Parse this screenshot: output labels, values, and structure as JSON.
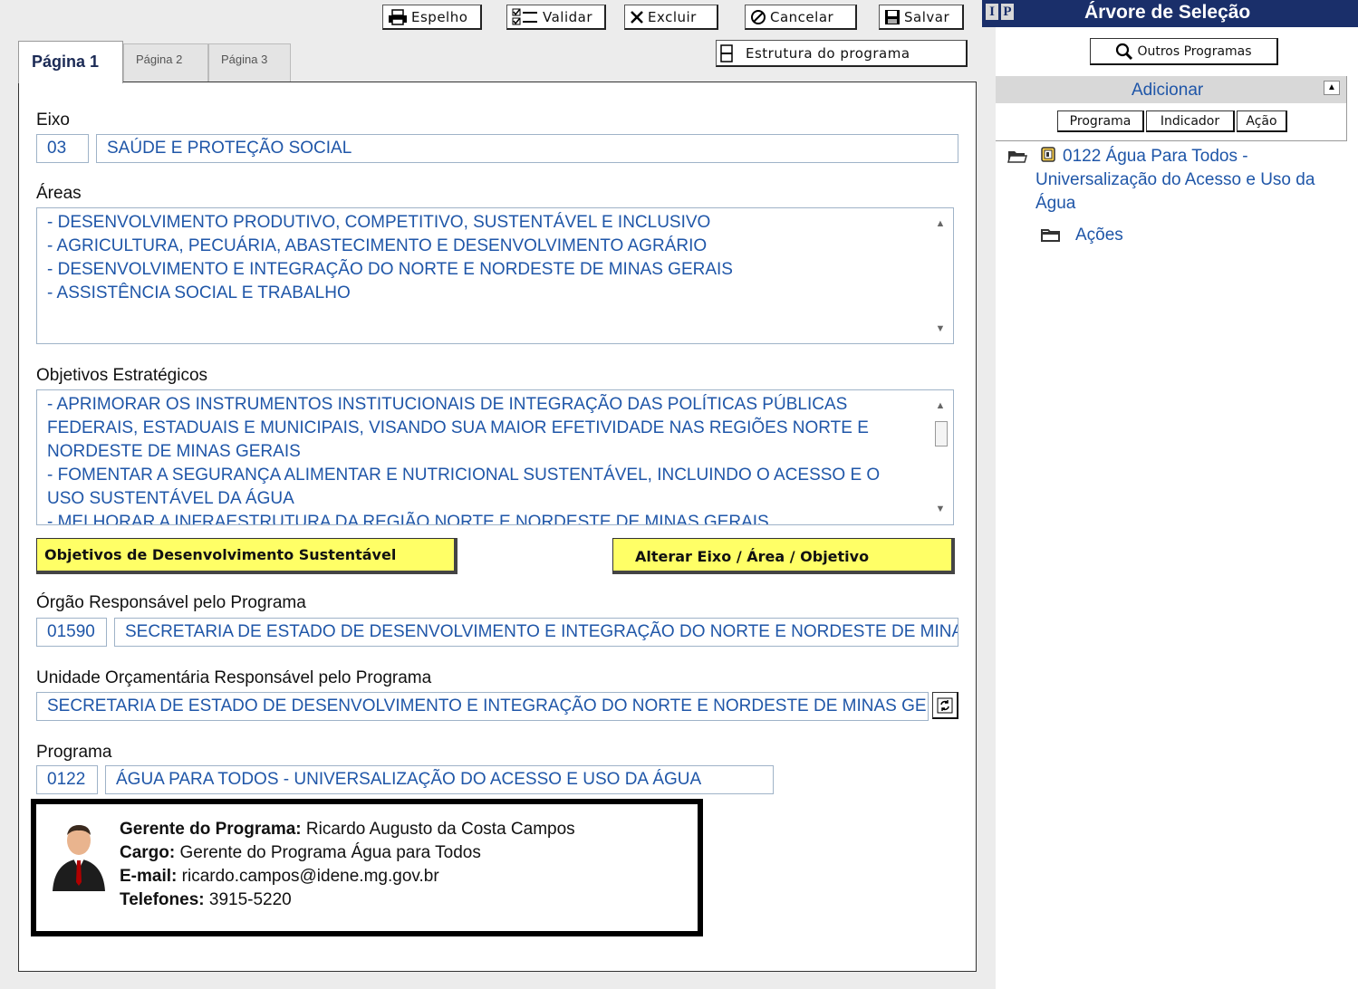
{
  "toolbar": {
    "espelho": "Espelho",
    "validar": "Validar",
    "excluir": "Excluir",
    "cancelar": "Cancelar",
    "salvar": "Salvar",
    "estrutura": "Estrutura do programa"
  },
  "tabs": [
    {
      "label": "Página 1",
      "active": true
    },
    {
      "label": "Página 2",
      "active": false
    },
    {
      "label": "Página 3",
      "active": false
    }
  ],
  "form": {
    "eixo": {
      "label": "Eixo",
      "code": "03",
      "name": "SAÚDE E PROTEÇÃO SOCIAL"
    },
    "areas": {
      "label": "Áreas",
      "items": [
        "- DESENVOLVIMENTO PRODUTIVO, COMPETITIVO, SUSTENTÁVEL E INCLUSIVO",
        "- AGRICULTURA, PECUÁRIA, ABASTECIMENTO E DESENVOLVIMENTO AGRÁRIO",
        "- DESENVOLVIMENTO E INTEGRAÇÃO DO NORTE E NORDESTE DE MINAS GERAIS",
        "- ASSISTÊNCIA SOCIAL E TRABALHO"
      ]
    },
    "objetivos": {
      "label": "Objetivos Estratégicos",
      "items": [
        "- APRIMORAR OS INSTRUMENTOS INSTITUCIONAIS DE INTEGRAÇÃO DAS POLÍTICAS PÚBLICAS FEDERAIS, ESTADUAIS E MUNICIPAIS, VISANDO SUA MAIOR EFETIVIDADE NAS REGIÕES NORTE E NORDESTE DE MINAS GERAIS",
        "- FOMENTAR A SEGURANÇA ALIMENTAR E NUTRICIONAL SUSTENTÁVEL, INCLUINDO O ACESSO E O USO SUSTENTÁVEL DA ÁGUA",
        "- MELHORAR A INFRAESTRUTURA DA REGIÃO NORTE E NORDESTE DE MINAS GERAIS"
      ]
    },
    "btn_ods": "Objetivos de Desenvolvimento Sustentável",
    "btn_alterar": "Alterar Eixo / Área / Objetivo",
    "orgao": {
      "label": "Órgão Responsável pelo Programa",
      "code": "01590",
      "name": "SECRETARIA DE ESTADO DE DESENVOLVIMENTO E INTEGRAÇÃO DO NORTE E NORDESTE DE MINAS GERAIS"
    },
    "unidade": {
      "label": "Unidade Orçamentária Responsável pelo Programa",
      "name": "SECRETARIA DE ESTADO DE DESENVOLVIMENTO E INTEGRAÇÃO DO NORTE E NORDESTE DE MINAS GERAIS"
    },
    "programa": {
      "label": "Programa",
      "code": "0122",
      "name": "ÁGUA PARA TODOS - UNIVERSALIZAÇÃO DO ACESSO E USO DA ÁGUA"
    }
  },
  "manager": {
    "gerente_label": "Gerente do Programa:",
    "gerente_value": "Ricardo Augusto da Costa Campos",
    "cargo_label": "Cargo:",
    "cargo_value": "Gerente do Programa Água para Todos",
    "email_label": "E-mail:",
    "email_value": "ricardo.campos@idene.mg.gov.br",
    "telefones_label": "Telefones:",
    "telefones_value": "3915-5220"
  },
  "right_panel": {
    "title": "Árvore de Seleção",
    "header_letters": [
      "I",
      "P"
    ],
    "outros_programas": "Outros Programas",
    "adicionar": "Adicionar",
    "add_buttons": [
      "Programa",
      "Indicador",
      "Ação"
    ],
    "tree": {
      "program": "0122 Água Para Todos - Universalização do Acesso e Uso da Água",
      "child": "Ações"
    }
  },
  "colors": {
    "field_text": "#1f56a8",
    "header_bg": "#1a2f6a",
    "button_yellow": "#ffff66"
  }
}
